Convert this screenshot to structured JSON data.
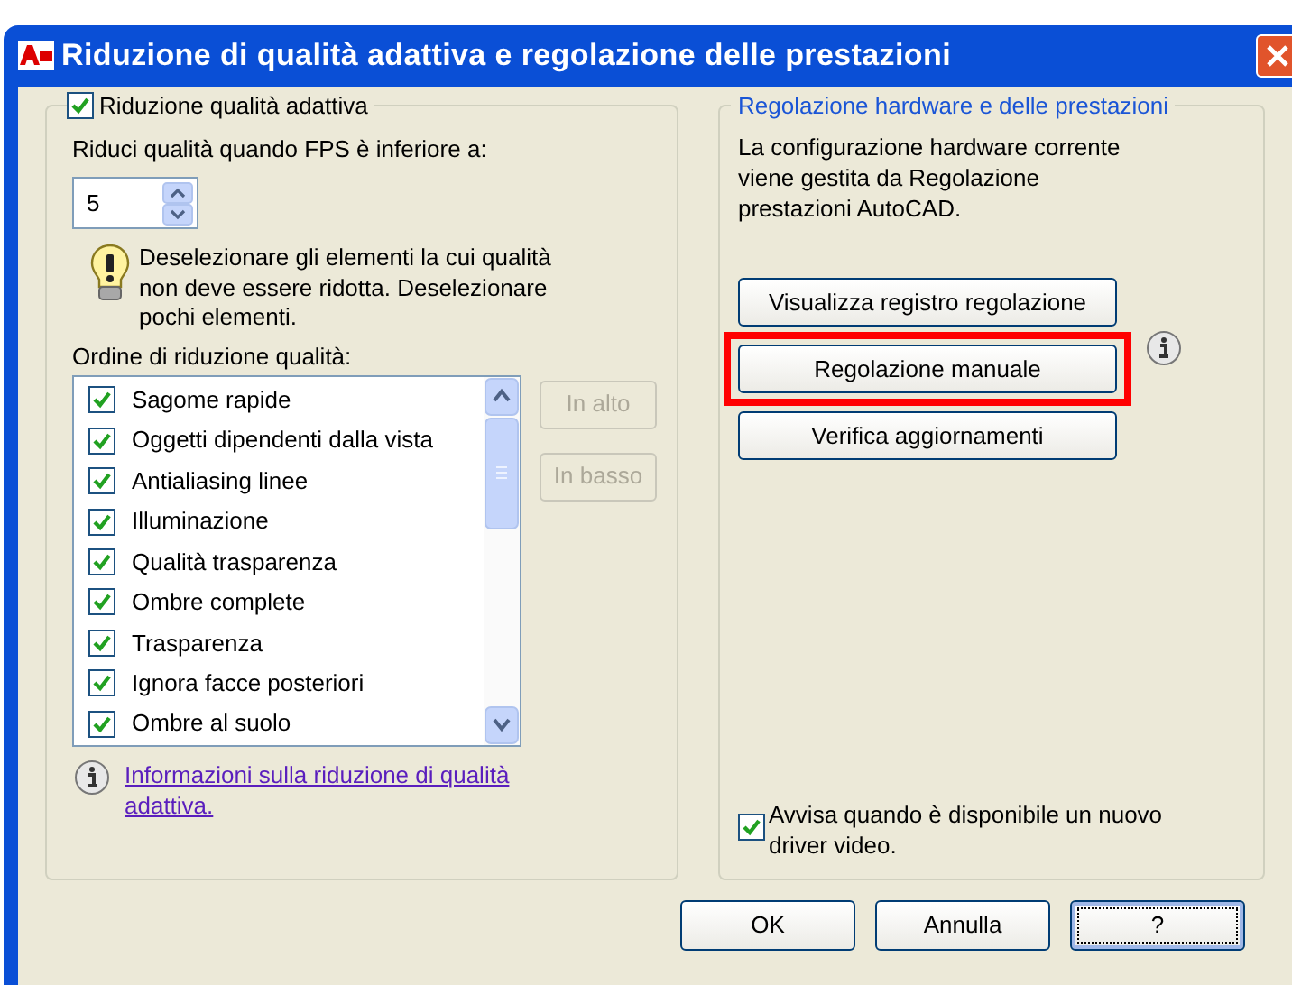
{
  "window": {
    "title": "Riduzione di qualità adattiva e regolazione delle prestazioni"
  },
  "left_group": {
    "checkbox": {
      "label": "Riduzione qualità adattiva",
      "checked": true
    },
    "fps_label": "Riduci qualità quando FPS è inferiore a:",
    "fps_value": "5",
    "tip": "Deselezionare gli elementi la cui qualità non deve essere ridotta. Deselezionare pochi elementi.",
    "list_label": "Ordine di riduzione qualità:",
    "list_items": [
      {
        "label": "Sagome rapide",
        "checked": true
      },
      {
        "label": "Oggetti dipendenti dalla vista",
        "checked": true
      },
      {
        "label": "Antialiasing linee",
        "checked": true
      },
      {
        "label": "Illuminazione",
        "checked": true
      },
      {
        "label": "Qualità trasparenza",
        "checked": true
      },
      {
        "label": "Ombre complete",
        "checked": true
      },
      {
        "label": "Trasparenza",
        "checked": true
      },
      {
        "label": "Ignora facce posteriori",
        "checked": true
      },
      {
        "label": "Ombre al suolo",
        "checked": true
      }
    ],
    "move_buttons": [
      {
        "label": "In alto",
        "disabled": true
      },
      {
        "label": "In basso",
        "disabled": true
      }
    ],
    "info_link": "Informazioni sulla riduzione di qualità adattiva."
  },
  "right_group": {
    "title": "Regolazione hardware e delle prestazioni",
    "description": "La configurazione hardware corrente viene gestita da Regolazione prestazioni AutoCAD.",
    "buttons": [
      {
        "label": "Visualizza registro regolazione",
        "highlighted": false,
        "info": false
      },
      {
        "label": "Regolazione manuale",
        "highlighted": true,
        "info": true
      },
      {
        "label": "Verifica aggiornamenti",
        "highlighted": false,
        "info": false
      }
    ],
    "notify_checkbox": {
      "label": "Avvisa quando è disponibile un nuovo driver video.",
      "checked": true
    }
  },
  "buttons": [
    {
      "label": "OK",
      "focused": false
    },
    {
      "label": "Annulla",
      "focused": false
    },
    {
      "label": "?",
      "focused": true
    }
  ]
}
